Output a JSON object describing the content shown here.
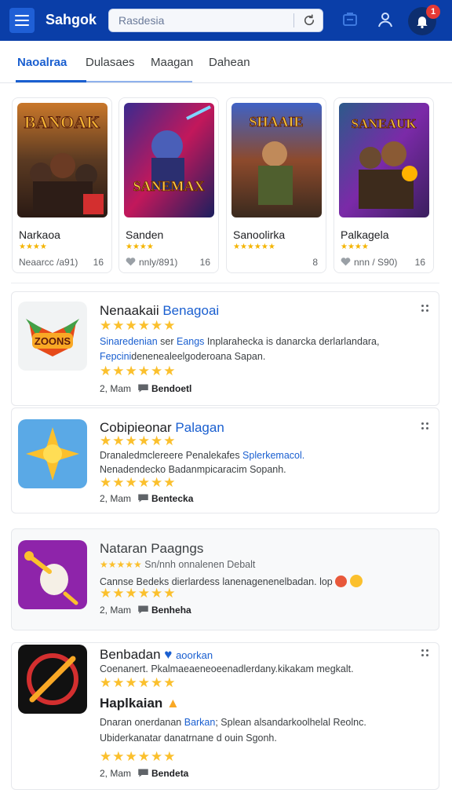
{
  "topbar": {
    "app_title": "Sahgok",
    "search_value": "Rasdesia",
    "notification_count": "1",
    "colors": {
      "bar": "#0a3ea8",
      "accent": "#1a5fd0",
      "badge": "#e53935"
    }
  },
  "tabs": [
    {
      "label": "Naoalraa",
      "active": true
    },
    {
      "label": "Dulasaes",
      "active": false
    },
    {
      "label": "Maagan",
      "active": false
    },
    {
      "label": "Dahean",
      "active": false
    }
  ],
  "featured": [
    {
      "title": "Narkaoa",
      "stars": "★★★★",
      "meta": "Neaarcc /a91)",
      "count": "16"
    },
    {
      "title": "Sanden",
      "stars": "★★★★",
      "meta": "nnly/891)",
      "count": "16"
    },
    {
      "title": "Sanoolirka",
      "stars": "★★★★★★",
      "meta": "",
      "count": "8"
    },
    {
      "title": "Palkagela",
      "stars": "★★★★",
      "meta": "nnn / S90)",
      "count": "16"
    }
  ],
  "featured_art_text": [
    "BANOAK",
    "SANEMAX",
    "SHAAIE",
    "SANEAUK"
  ],
  "list": [
    {
      "title": "Nenaakaii ",
      "title_accent": "Benagoai",
      "stars_top": "★★★★★★",
      "desc1_accent": "Sinaredenian",
      "desc1": " ser ",
      "desc1_accent2": "Eangs",
      "desc1_tail": " Inplarahecka is danarcka derlarlandara,",
      "desc2_accent": "Fepcini",
      "desc2": "denenealeelgoderoana Sapan.",
      "stars_bottom": "★★★★★★",
      "meta_num": "2, Mam",
      "meta_label": "Bendoetl"
    },
    {
      "title": "Cobipieonar ",
      "title_accent": "Palagan",
      "stars_top": "★★★★★★",
      "desc1": "Dranaledmclereere Penalekafes ",
      "desc1_accent": "Splerkemacol.",
      "desc2": "Nenadendecko Badanmpicaracim Sopanh.",
      "stars_bottom": "★★★★★★",
      "meta_num": "2, Mam",
      "meta_label": "Bentecka"
    },
    {
      "title": "Nataran Paagngs",
      "desc1": "Sn/nnh onnalenen Debalt",
      "desc2": "Cannse Bedeks dierlardess lanenagenenelbadan. lop",
      "stars_bottom": "★★★★★★",
      "meta_num": "2, Mam",
      "meta_label": "Benheha"
    },
    {
      "title": "Benbadan ",
      "title_accent": "aoorkan",
      "desc1": "Coenanert. Pkalmaeaeneoeenadlerdany.kikakam megkalt.",
      "stars_mid": "★★★★★★",
      "subtitle": "Haplkaian",
      "desc2": "Dnaran onerdanan ",
      "desc2_accent": "Barkan",
      "desc2_tail": "; Splean alsandarkoolhelal Reolnc.",
      "desc3": "Ubiderkanatar danatrnane d ouin Sgonh.",
      "stars_bottom": "★★★★★★",
      "meta_num": "2, Mam",
      "meta_label": "Bendeta"
    }
  ]
}
